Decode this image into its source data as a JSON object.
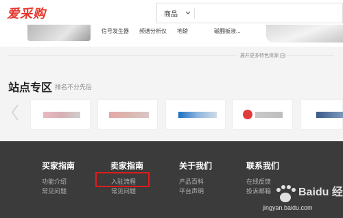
{
  "header": {
    "logo": "爱采购",
    "search_category": "商品"
  },
  "banner": {
    "categories": [
      "信号发生器",
      "频谱分析仪",
      "地磅",
      "磁翻板液..."
    ]
  },
  "more": {
    "label": "展开更多特色资源"
  },
  "section": {
    "title": "站点专区",
    "subtitle": "排名不分先后"
  },
  "footer": {
    "columns": [
      {
        "title": "买家指南",
        "links": [
          "功能介绍",
          "常见问题"
        ]
      },
      {
        "title": "卖家指南",
        "links": [
          "入驻流程",
          "常见问题"
        ]
      },
      {
        "title": "关于我们",
        "links": [
          "产品百科",
          "平台声明"
        ]
      },
      {
        "title": "联系我们",
        "links": [
          "在线反馈",
          "投诉邮箱"
        ]
      }
    ]
  },
  "watermark": {
    "text": "Baidu 经验",
    "url": "jingyan.baidu.com"
  },
  "colors": {
    "brand": "#e5362c",
    "footer_bg": "#3b3b3b",
    "highlight": "#e01b1b"
  }
}
